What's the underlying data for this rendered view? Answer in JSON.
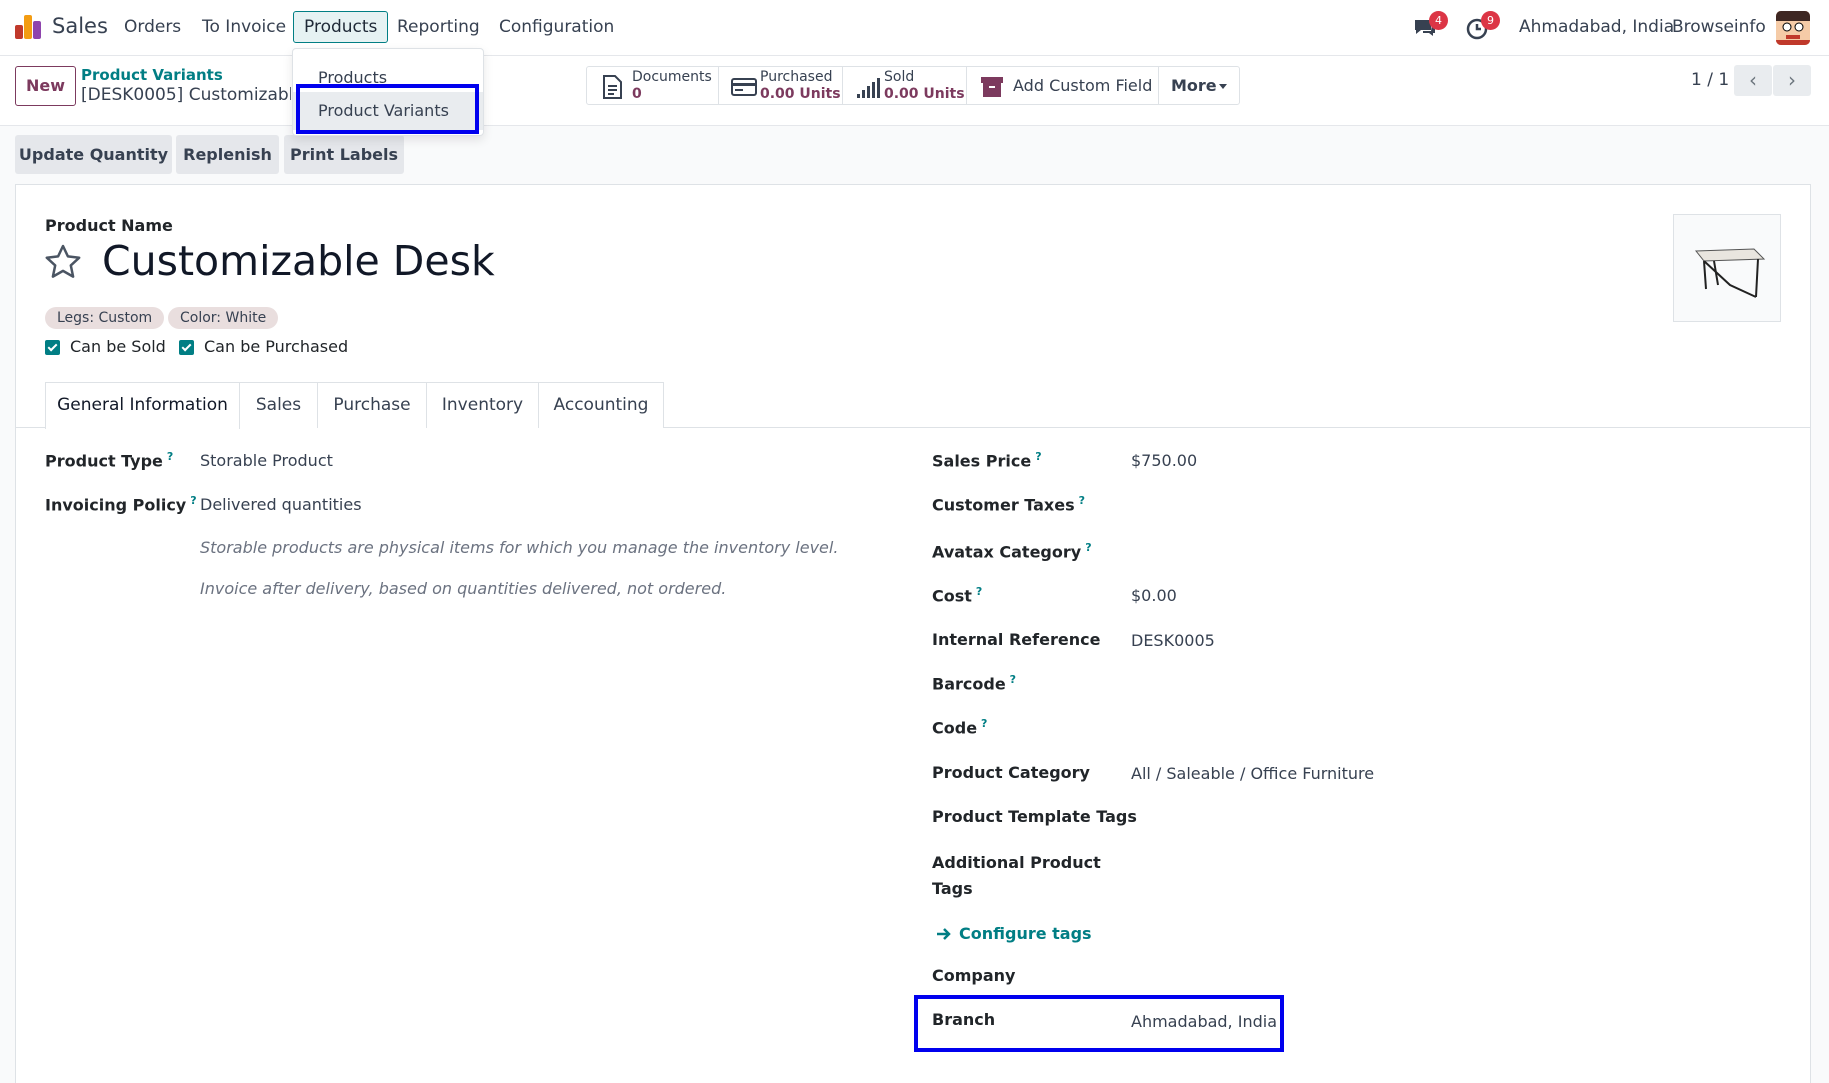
{
  "navbar": {
    "app_name": "Sales",
    "menu": [
      "Orders",
      "To Invoice",
      "Products",
      "Reporting",
      "Configuration"
    ],
    "chat_badge": "4",
    "activity_badge": "9",
    "branch": "Ahmadabad, India",
    "company": "Browseinfo"
  },
  "products_dropdown": {
    "items": [
      "Products",
      "Product Variants"
    ]
  },
  "control_panel": {
    "new_label": "New",
    "breadcrumb_parent": "Product Variants",
    "breadcrumb_current": "[DESK0005] Customizable Desk",
    "stats": [
      {
        "label": "Documents",
        "value": "0"
      },
      {
        "label": "Purchased",
        "value": "0.00 Units"
      },
      {
        "label": "Sold",
        "value": "0.00 Units"
      }
    ],
    "add_custom_field": "Add Custom Field",
    "more_label": "More",
    "pager": "1 / 1"
  },
  "actions": [
    "Update Quantity",
    "Replenish",
    "Print Labels"
  ],
  "form": {
    "product_name_label": "Product Name",
    "product_name": "Customizable Desk",
    "attribute_tags": [
      "Legs: Custom",
      "Color: White"
    ],
    "can_be_sold": "Can be Sold",
    "can_be_purchased": "Can be Purchased",
    "tabs": [
      "General Information",
      "Sales",
      "Purchase",
      "Inventory",
      "Accounting"
    ],
    "left_fields": [
      {
        "label": "Product Type",
        "value": "Storable Product"
      },
      {
        "label": "Invoicing Policy",
        "value": "Delivered quantities"
      }
    ],
    "help_texts": [
      "Storable products are physical items for which you manage the inventory level.",
      "Invoice after delivery, based on quantities delivered, not ordered."
    ],
    "right_fields": [
      {
        "label": "Sales Price",
        "value": "$750.00"
      },
      {
        "label": "Customer Taxes",
        "value": ""
      },
      {
        "label": "Avatax Category",
        "value": ""
      },
      {
        "label": "Cost",
        "value": "$0.00"
      },
      {
        "label": "Internal Reference",
        "value": "DESK0005"
      },
      {
        "label": "Barcode",
        "value": ""
      },
      {
        "label": "Code",
        "value": ""
      },
      {
        "label": "Product Category",
        "value": "All / Saleable / Office Furniture"
      },
      {
        "label": "Product Template Tags",
        "value": ""
      },
      {
        "label": "Additional Product",
        "value": ""
      },
      {
        "label": "Tags",
        "value": ""
      },
      {
        "label": "Company",
        "value": ""
      },
      {
        "label": "Branch",
        "value": "Ahmadabad, India"
      }
    ],
    "configure_tags": "Configure tags"
  },
  "colors": {
    "primary": "#7c3a5e",
    "teal": "#017e84",
    "highlight": "#0000ee"
  }
}
